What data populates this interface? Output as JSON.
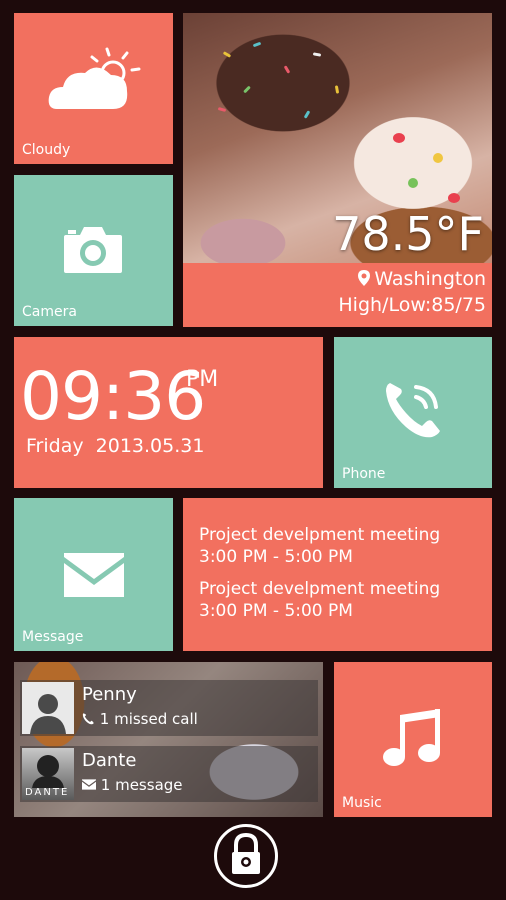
{
  "weather_tile": {
    "label": "Cloudy",
    "temperature": "78.5°F",
    "city": "Washington",
    "high_low": "High/Low:85/75"
  },
  "camera_tile": {
    "label": "Camera"
  },
  "clock_tile": {
    "time": "09:36",
    "ampm": "PM",
    "date": "Friday  2013.05.31"
  },
  "phone_tile": {
    "label": "Phone"
  },
  "message_tile": {
    "label": "Message"
  },
  "calendar_tile": {
    "events": [
      {
        "title": "Project develpment meeting",
        "time": "3:00 PM - 5:00 PM"
      },
      {
        "title": "Project develpment meeting",
        "time": "3:00 PM - 5:00 PM"
      }
    ]
  },
  "contacts": [
    {
      "name": "Penny",
      "status": "1 missed call",
      "status_icon": "phone-icon"
    },
    {
      "name": "Dante",
      "status": "1 message",
      "status_icon": "envelope-icon",
      "avatar_text": "DANTE"
    }
  ],
  "music_tile": {
    "label": "Music"
  },
  "colors": {
    "coral": "#f2705f",
    "mint": "#86c9b2",
    "background": "#1d0a0b"
  }
}
